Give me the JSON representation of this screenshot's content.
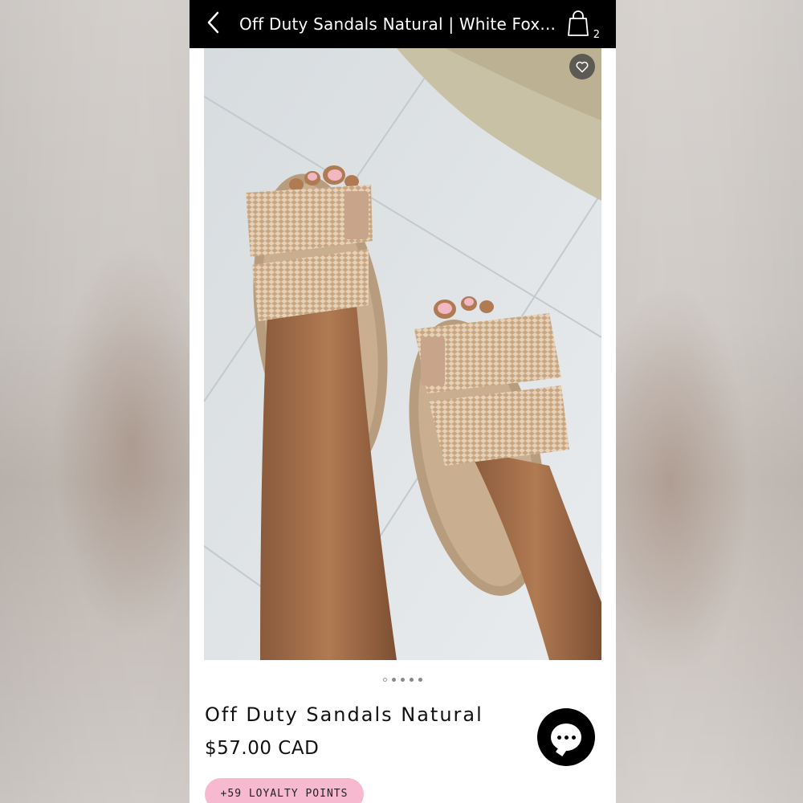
{
  "header": {
    "title": "Off Duty Sandals Natural | White Fox...",
    "back_icon": "chevron-left-icon",
    "bag_icon": "shopping-bag-icon",
    "bag_count": "2"
  },
  "gallery": {
    "favorite_icon": "heart-icon",
    "dot_count": 5,
    "active_dot": 0
  },
  "product": {
    "name": "Off Duty Sandals Natural",
    "price": "$57.00 CAD",
    "loyalty": "+59 LOYALTY POINTS"
  },
  "chat": {
    "icon": "chat-bubble-icon"
  },
  "colors": {
    "header_bg": "#000000",
    "loyalty_bg": "#f7b9cf",
    "chat_bg": "#000000"
  }
}
